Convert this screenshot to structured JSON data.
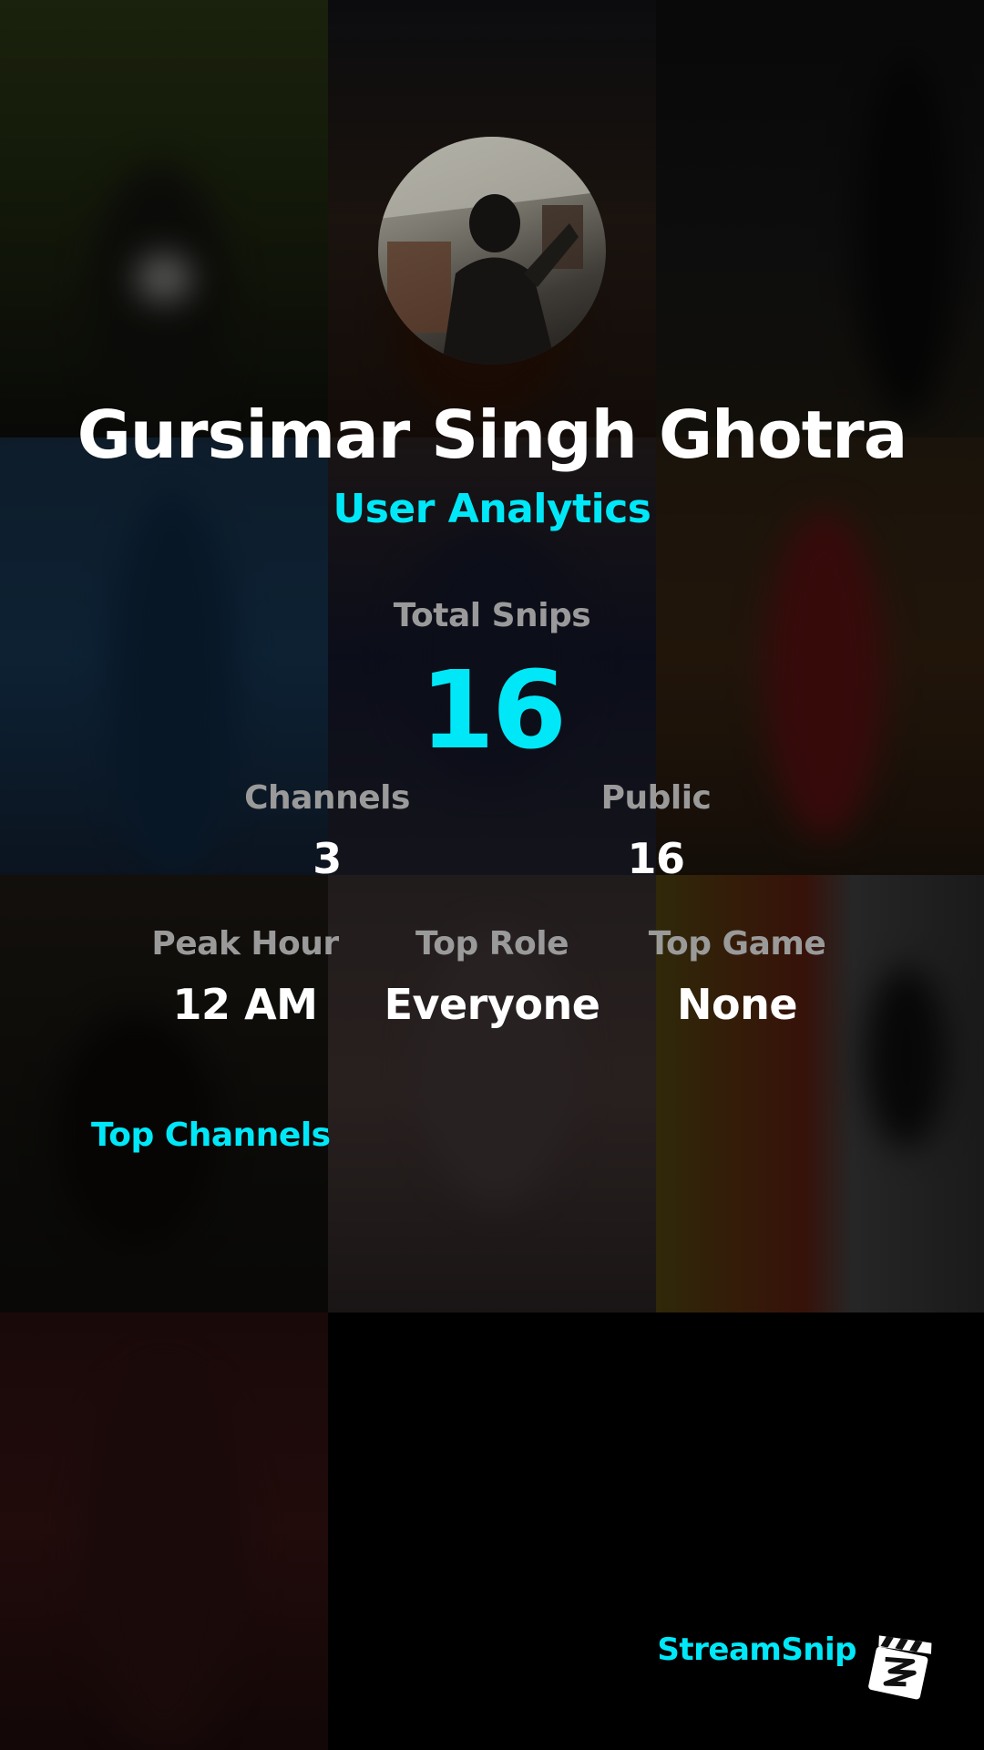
{
  "profile": {
    "name": "Gursimar Singh Ghotra",
    "subtitle": "User Analytics"
  },
  "stats": {
    "total_snips_label": "Total Snips",
    "total_snips_value": "16",
    "channels_label": "Channels",
    "channels_value": "3",
    "public_label": "Public",
    "public_value": "16",
    "peak_hour_label": "Peak Hour",
    "peak_hour_value": "12 AM",
    "top_role_label": "Top Role",
    "top_role_value": "Everyone",
    "top_game_label": "Top Game",
    "top_game_value": "None"
  },
  "sections": {
    "top_channels_title": "Top Channels"
  },
  "footer": {
    "brand_name": "StreamSnip",
    "brand_icon": "clapperboard-logo-icon"
  },
  "colors": {
    "accent": "#00e8f8",
    "label_gray": "#9a9a9a",
    "text": "#ffffff",
    "background": "#000000"
  }
}
